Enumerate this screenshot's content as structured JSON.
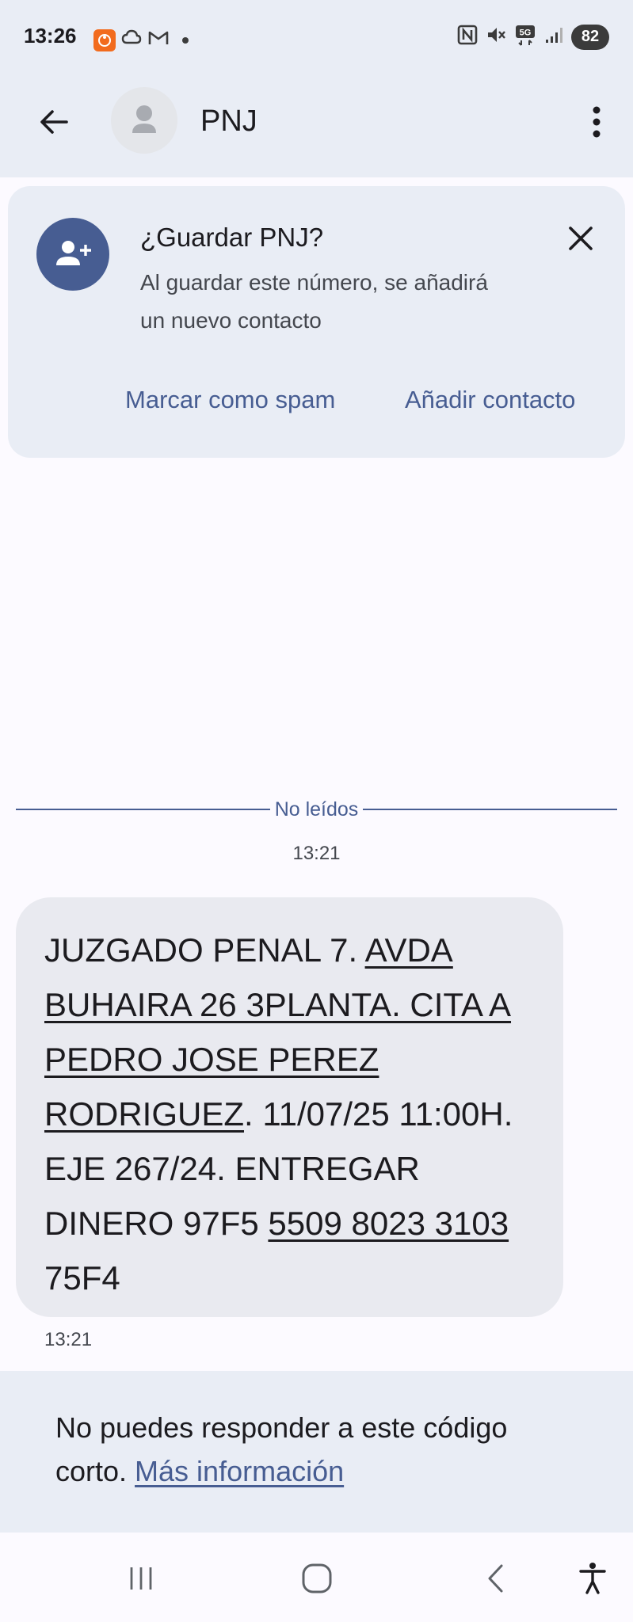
{
  "status_bar": {
    "time": "13:26",
    "battery": "82",
    "network": "5G"
  },
  "app_bar": {
    "title": "PNJ"
  },
  "save_card": {
    "title": "¿Guardar PNJ?",
    "body": "Al guardar este número, se añadirá un nuevo contacto",
    "spam_label": "Marcar como spam",
    "add_label": "Añadir contacto"
  },
  "divider": {
    "label": "No leídos"
  },
  "conversation": {
    "timestamp": "13:21",
    "message": {
      "segments": [
        {
          "text": "JUZGADO PENAL 7. ",
          "link": false
        },
        {
          "text": "AVDA BUHAIRA 26 3PLANTA. CITA A PEDRO JOSE PEREZ RODRIGUEZ",
          "link": true
        },
        {
          "text": ". 11/07/25 11:00H. EJE 267/24. ENTREGAR DINERO 97F5 ",
          "link": false
        },
        {
          "text": "5509 8023 3103",
          "link": true
        },
        {
          "text": " 75F4",
          "link": false
        }
      ],
      "time": "13:21"
    }
  },
  "reply_notice": {
    "text": "No puedes responder a este código corto. ",
    "link": "Más información"
  },
  "colors": {
    "accent": "#475d92",
    "surface": "#e9edf5",
    "bubble": "#e9eaf0",
    "background": "#fcfaff",
    "app_badge": "#f26b1d"
  },
  "icons": {
    "back": "arrow-back-icon",
    "avatar": "person-icon",
    "overflow": "more-vert-icon",
    "add_contact": "person-add-icon",
    "close": "close-icon",
    "nav_recents": "recents-icon",
    "nav_home": "home-icon",
    "nav_back": "nav-back-icon",
    "accessibility": "accessibility-icon"
  }
}
